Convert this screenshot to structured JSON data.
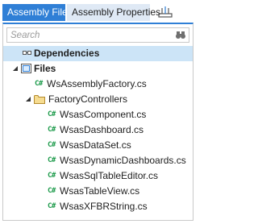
{
  "tabs": {
    "assembly_files": "Assembly Files",
    "assembly_properties": "Assembly Properties",
    "extra_icon": "tree-toggle-icon"
  },
  "search": {
    "placeholder": "Search",
    "value": ""
  },
  "tree": {
    "dependencies": {
      "label": "Dependencies",
      "selected": true
    },
    "files": {
      "label": "Files",
      "expanded": true
    },
    "ws_assembly_factory": {
      "badge": "C#",
      "label": "WsAssemblyFactory.cs"
    },
    "factory_controllers": {
      "label": "FactoryControllers",
      "expanded": true
    },
    "children": [
      {
        "badge": "C#",
        "label": "WsasComponent.cs"
      },
      {
        "badge": "C#",
        "label": "WsasDashboard.cs"
      },
      {
        "badge": "C#",
        "label": "WsasDataSet.cs"
      },
      {
        "badge": "C#",
        "label": "WsasDynamicDashboards.cs"
      },
      {
        "badge": "C#",
        "label": "WsasSqlTableEditor.cs"
      },
      {
        "badge": "C#",
        "label": "WsasTableView.cs"
      },
      {
        "badge": "C#",
        "label": "WsasXFBRString.cs"
      }
    ]
  },
  "colors": {
    "accent": "#2f7fd6",
    "inactive_tab": "#dfe9f5",
    "selection": "#cce4f7",
    "csharp_badge": "#1c9a4a",
    "folder": "#e8c36a"
  }
}
